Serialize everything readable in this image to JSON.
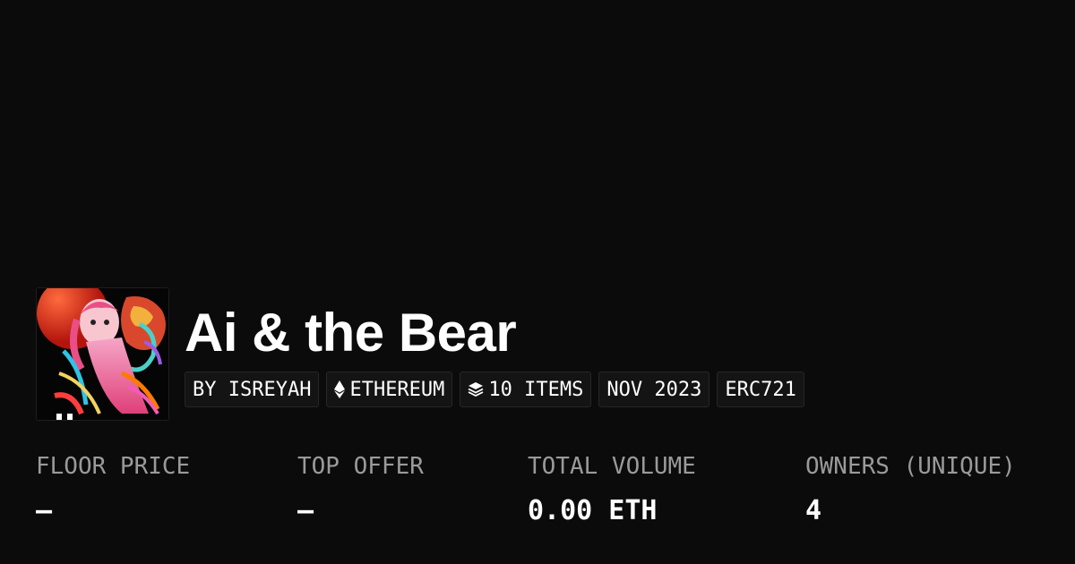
{
  "collection": {
    "title": "Ai & the Bear",
    "thumbnail_icon": "collection-artwork-thumbnail"
  },
  "tags": {
    "creator": "BY ISREYAH",
    "chain": "ETHEREUM",
    "chain_icon": "ethereum-icon",
    "items": "10 ITEMS",
    "items_icon": "layers-icon",
    "date": "NOV 2023",
    "standard": "ERC721"
  },
  "stats": [
    {
      "label": "FLOOR PRICE",
      "value": "—"
    },
    {
      "label": "TOP OFFER",
      "value": "—"
    },
    {
      "label": "TOTAL VOLUME",
      "value": "0.00 ETH"
    },
    {
      "label": "OWNERS (UNIQUE)",
      "value": "4"
    }
  ],
  "colors": {
    "background": "#0b0b0b",
    "tag_background": "#141414",
    "label": "#9a9a9a",
    "text": "#ffffff"
  }
}
